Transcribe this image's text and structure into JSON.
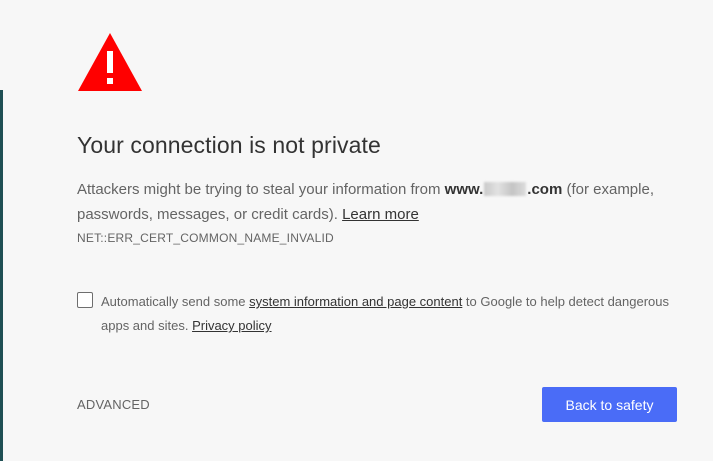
{
  "warning_icon": {
    "name": "warning-triangle-icon",
    "color": "#ff0000"
  },
  "title": "Your connection is not private",
  "explanation": {
    "text_before": "Attackers might be trying to steal your information from ",
    "domain_prefix": "www.",
    "domain_suffix": ".com",
    "text_after": " (for example, passwords, messages, or credit cards). ",
    "learn_more": "Learn more"
  },
  "error_code": "NET::ERR_CERT_COMMON_NAME_INVALID",
  "optin": {
    "text_before": "Automatically send some ",
    "link_system_info": "system information and page content",
    "text_middle": " to Google to help detect dangerous apps and sites. ",
    "link_privacy": "Privacy policy"
  },
  "advanced_label": "ADVANCED",
  "back_to_safety_label": "Back to safety",
  "colors": {
    "background": "#f7f7f7",
    "primary_button": "#4a6cf7",
    "warning_red": "#ff0000"
  }
}
